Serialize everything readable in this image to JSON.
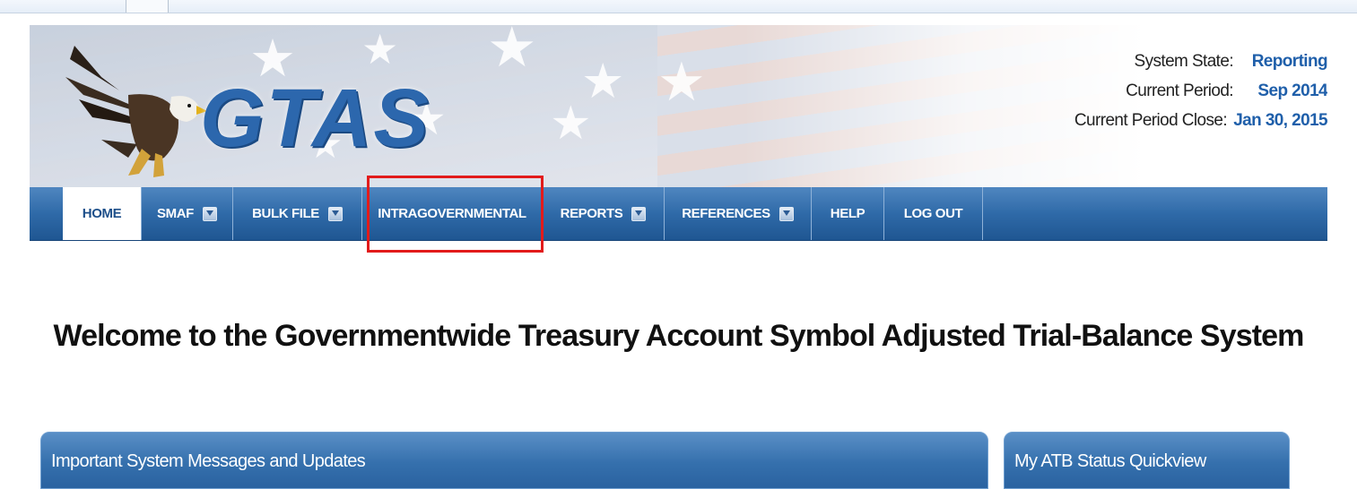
{
  "header": {
    "logo_text": "GTAS",
    "status": {
      "system_state_label": "System State:",
      "system_state_value": "Reporting",
      "current_period_label": "Current Period:",
      "current_period_value": "Sep 2014",
      "period_close_label": "Current Period Close:",
      "period_close_value": "Jan 30, 2015"
    }
  },
  "nav": {
    "items": [
      {
        "label": "HOME",
        "dropdown": false,
        "active": true
      },
      {
        "label": "SMAF",
        "dropdown": true
      },
      {
        "label": "BULK FILE",
        "dropdown": true
      },
      {
        "label": "INTRAGOVERNMENTAL",
        "dropdown": false,
        "highlighted": true
      },
      {
        "label": "REPORTS",
        "dropdown": true
      },
      {
        "label": "REFERENCES",
        "dropdown": true
      },
      {
        "label": "HELP",
        "dropdown": false
      },
      {
        "label": "LOG OUT",
        "dropdown": false
      }
    ]
  },
  "main": {
    "welcome": "Welcome to the Governmentwide Treasury Account Symbol Adjusted Trial-Balance System"
  },
  "panels": {
    "messages_title": "Important System Messages and Updates",
    "atb_title": "My ATB Status Quickview"
  },
  "colors": {
    "nav_blue": "#2f6aa8",
    "status_value": "#1f5faa",
    "highlight_red": "#e21b1b"
  }
}
